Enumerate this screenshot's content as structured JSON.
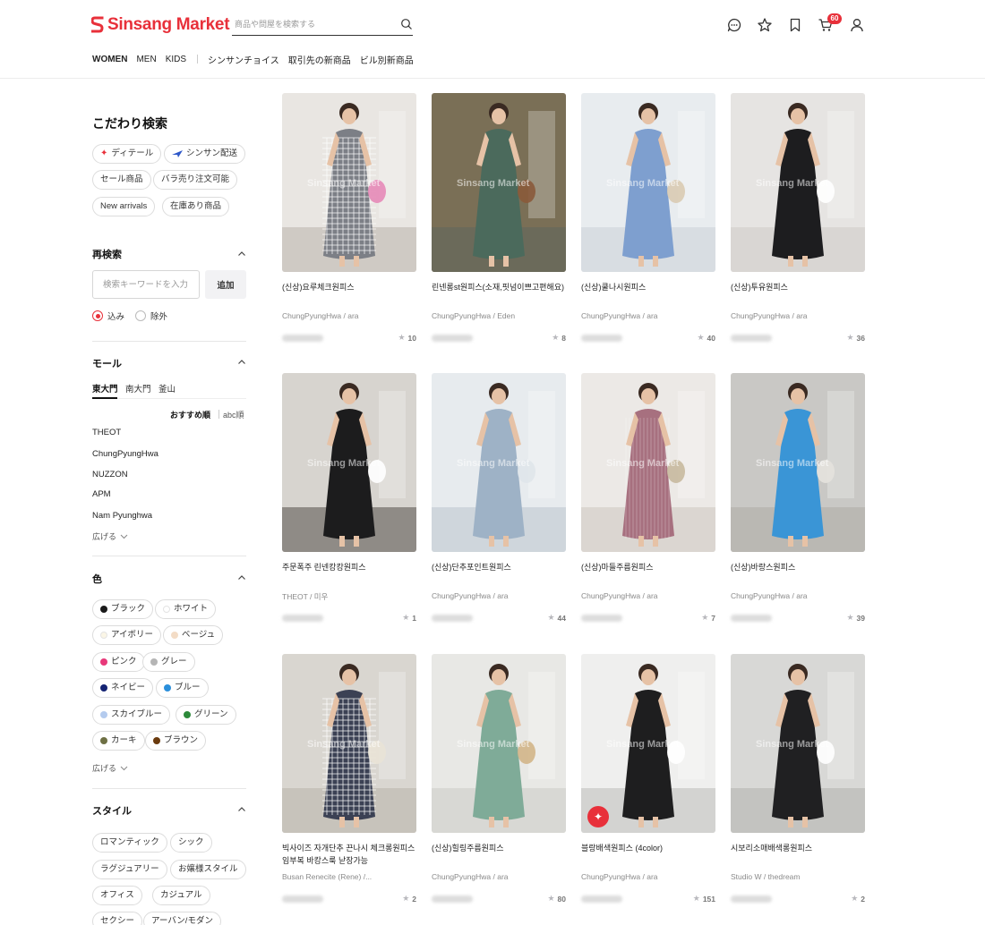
{
  "header": {
    "logo_text": "Sinsang Market",
    "search_placeholder": "商品や問屋を検索する",
    "cart_count": "60",
    "nav": [
      "WOMEN",
      "MEN",
      "KIDS"
    ],
    "nav2": [
      "シンサンチョイス",
      "取引先の新商品",
      "ビル別新商品"
    ]
  },
  "sidebar": {
    "title": "こだわり検索",
    "filter_chips": [
      "ディテール",
      "シンサン配送",
      "セール商品",
      "バラ売り注文可能",
      "New arrivals",
      "在庫あり商品"
    ],
    "research": {
      "title": "再検索",
      "placeholder": "検索キーワードを入力",
      "add_label": "追加",
      "include_label": "込み",
      "exclude_label": "除外"
    },
    "mall": {
      "title": "モール",
      "tabs": [
        "東大門",
        "南大門",
        "釜山"
      ],
      "sort_recommended": "おすすめ順",
      "sort_abc": "abc順",
      "items": [
        "THEOT",
        "ChungPyungHwa",
        "NUZZON",
        "APM",
        "Nam Pyunghwa"
      ],
      "expand_label": "広げる"
    },
    "color": {
      "title": "色",
      "options": [
        {
          "label": "ブラック",
          "color": "#1a1a1a"
        },
        {
          "label": "ホワイト",
          "color": "#ffffff"
        },
        {
          "label": "アイボリー",
          "color": "#fbf6e6"
        },
        {
          "label": "ベージュ",
          "color": "#f3dcc6"
        },
        {
          "label": "ピンク",
          "color": "#e8397a"
        },
        {
          "label": "グレー",
          "color": "#b5b5b5"
        },
        {
          "label": "ネイビー",
          "color": "#142373"
        },
        {
          "label": "ブルー",
          "color": "#2b8fdb"
        },
        {
          "label": "スカイブルー",
          "color": "#b4cbee"
        },
        {
          "label": "グリーン",
          "color": "#2d8a3a"
        },
        {
          "label": "カーキ",
          "color": "#6e7044"
        },
        {
          "label": "ブラウン",
          "color": "#6b3b0e"
        }
      ],
      "expand_label": "広げる"
    },
    "style": {
      "title": "スタイル",
      "options": [
        "ロマンティック",
        "シック",
        "ラグジュアリー",
        "お嬢様スタイル",
        "オフィス",
        "カジュアル",
        "セクシー",
        "アーバン/モダン"
      ]
    }
  },
  "products": [
    {
      "name": "(신상)요루체크원피스",
      "brand": "ChungPyungHwa / ara",
      "likes": "10"
    },
    {
      "name": "린넨롱st원피스(소재,핏넘이쁘고편해요)",
      "brand": "ChungPyungHwa / Eden",
      "likes": "8"
    },
    {
      "name": "(신상)쿨나시원피스",
      "brand": "ChungPyungHwa / ara",
      "likes": "40"
    },
    {
      "name": "(신상)투유원피스",
      "brand": "ChungPyungHwa / ara",
      "likes": "36"
    },
    {
      "name": "주문폭주 린넨캉캉원피스",
      "brand": "THEOT / 미우",
      "likes": "1"
    },
    {
      "name": "(신상)단추포인트원피스",
      "brand": "ChungPyungHwa / ara",
      "likes": "44"
    },
    {
      "name": "(신상)마들주름원피스",
      "brand": "ChungPyungHwa / ara",
      "likes": "7"
    },
    {
      "name": "(신상)바랑스원피스",
      "brand": "ChungPyungHwa / ara",
      "likes": "39"
    },
    {
      "name": "빅사이즈 자개단추 끈나시 체크롱원피스 임부복 바캉스룩 낟장가능",
      "brand": "Busan Renecite (Rene) /...",
      "likes": "2"
    },
    {
      "name": "(신상)힐링주름원피스",
      "brand": "ChungPyungHwa / ara",
      "likes": "80"
    },
    {
      "name": "블랑배색원피스 (4color)",
      "brand": "ChungPyungHwa / ara",
      "likes": "151"
    },
    {
      "name": "시보리소매배색롱원피스",
      "brand": "Studio W / thedream",
      "likes": "2"
    }
  ],
  "watermark": "Sinsang Market",
  "colors": {
    "brand_red": "#e8303a"
  }
}
